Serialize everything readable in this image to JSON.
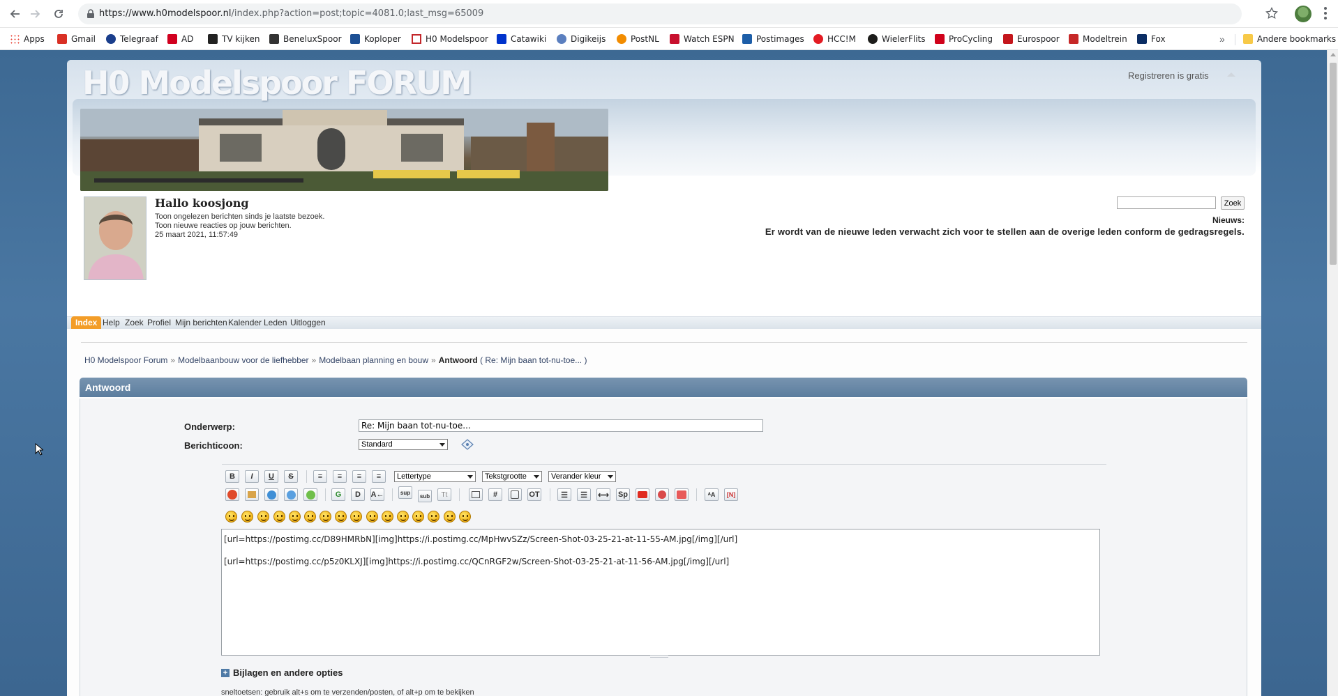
{
  "browser": {
    "url_host": "https://www.h0modelspoor.nl",
    "url_path": "/index.php?action=post;topic=4081.0;last_msg=65009",
    "bookmarks": [
      {
        "label": "Apps",
        "color": "#4285f4"
      },
      {
        "label": "Gmail",
        "color": "#d93025"
      },
      {
        "label": "Telegraaf",
        "color": "#1a3e8c"
      },
      {
        "label": "AD",
        "color": "#d1001f"
      },
      {
        "label": "TV kijken",
        "color": "#222222"
      },
      {
        "label": "BeneluxSpoor",
        "color": "#333333"
      },
      {
        "label": "Koploper",
        "color": "#1c4f94"
      },
      {
        "label": "H0 Modelspoor",
        "color": "#c3272b"
      },
      {
        "label": "Catawiki",
        "color": "#0033cc"
      },
      {
        "label": "Digikeijs",
        "color": "#5b7fbf"
      },
      {
        "label": "PostNL",
        "color": "#f28c00"
      },
      {
        "label": "Watch ESPN",
        "color": "#c8102e"
      },
      {
        "label": "Postimages",
        "color": "#1d5ea8"
      },
      {
        "label": "HCC!M",
        "color": "#e31b23"
      },
      {
        "label": "WielerFlits",
        "color": "#1d1d1b"
      },
      {
        "label": "ProCycling",
        "color": "#d0021b"
      },
      {
        "label": "Eurospoor",
        "color": "#c4161c"
      },
      {
        "label": "Modeltrein",
        "color": "#c62828"
      },
      {
        "label": "Fox",
        "color": "#0b2d64"
      }
    ],
    "more_label": "»",
    "other_bookmarks": "Andere bookmarks"
  },
  "header": {
    "forum_title": "H0 Modelspoor FORUM",
    "register": "Registreren is gratis"
  },
  "user": {
    "greeting": "Hallo koosjong",
    "unread": "Toon ongelezen berichten sinds je laatste bezoek.",
    "replies": "Toon nieuwe reacties op jouw berichten.",
    "datetime": "25 maart 2021, 11:57:49"
  },
  "search": {
    "button": "Zoek",
    "value": ""
  },
  "news": {
    "label": "Nieuws:",
    "text": "Er wordt van de nieuwe leden verwacht zich voor te stellen aan de overige leden conform de gedragsregels."
  },
  "menu": [
    "Index",
    "Help",
    "Zoek",
    "Profiel",
    "Mijn berichten",
    "Kalender",
    "Leden",
    "Uitloggen"
  ],
  "breadcrumb": {
    "items": [
      "H0 Modelspoor Forum",
      "Modelbaanbouw voor de liefhebber",
      "Modelbaan planning en bouw"
    ],
    "separator": "»",
    "current": "Antwoord",
    "current_sub": "( Re: Mijn baan tot-nu-toe... )"
  },
  "form": {
    "section_title": "Antwoord",
    "subject_label": "Onderwerp:",
    "subject_value": "Re: Mijn baan tot-nu-toe...",
    "icon_label": "Berichticoon:",
    "icon_value": "Standard",
    "font_select": "Lettertype",
    "size_select": "Tekstgrootte",
    "color_select": "Verander kleur",
    "body_lines": [
      "[url=https://postimg.cc/D89HMRbN][img]https://i.postimg.cc/MpHwvSZz/Screen-Shot-03-25-21-at-11-55-AM.jpg[/img][/url]",
      "",
      "[url=https://postimg.cc/p5z0KLXJ][img]https://i.postimg.cc/QCnRGF2w/Screen-Shot-03-25-21-at-11-56-AM.jpg[/img][/url]"
    ],
    "attachments_label": "Bijlagen en andere opties",
    "hotkeys": "sneltoetsen: gebruik alt+s om te verzenden/posten, of alt+p om te bekijken"
  },
  "toolbar": {
    "row1": [
      "B",
      "I",
      "U",
      "S"
    ],
    "row2_text": [
      "sup",
      "sub",
      "Tt",
      "OT",
      "Sp"
    ]
  },
  "colors": {
    "accent_orange": "#f39d28",
    "cat_bar": "#5c7d9e",
    "page_bg": "#3e6a93"
  }
}
